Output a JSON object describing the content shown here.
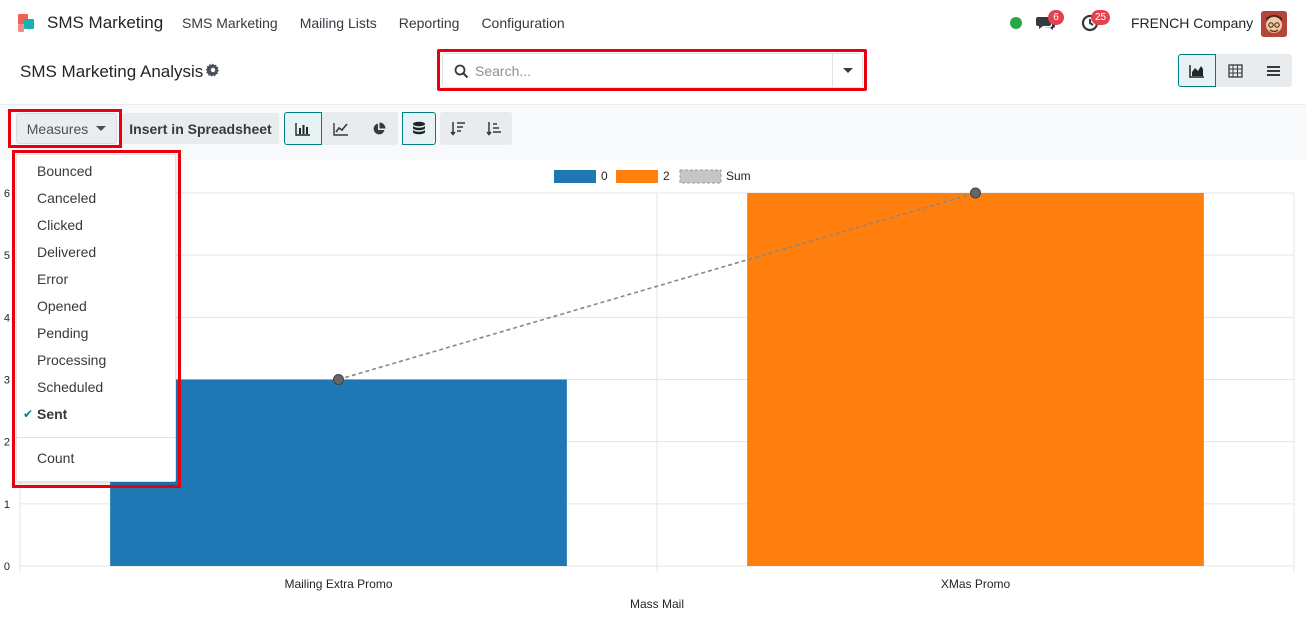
{
  "navbar": {
    "app_title": "SMS Marketing",
    "menu": [
      "SMS Marketing",
      "Mailing Lists",
      "Reporting",
      "Configuration"
    ],
    "chat_count": "6",
    "activity_count": "25",
    "company": "FRENCH Company"
  },
  "control_panel": {
    "title": "SMS Marketing Analysis",
    "search_placeholder": "Search..."
  },
  "toolbar": {
    "measures_label": "Measures",
    "spreadsheet_label": "Insert in Spreadsheet"
  },
  "measures_menu": {
    "items": [
      "Bounced",
      "Canceled",
      "Clicked",
      "Delivered",
      "Error",
      "Opened",
      "Pending",
      "Processing",
      "Scheduled",
      "Sent"
    ],
    "selected": "Sent",
    "count_label": "Count"
  },
  "colors": {
    "accent": "#017e84",
    "series_0": "#1f77b4",
    "series_2": "#ff7f0e",
    "highlight": "#e8000f"
  },
  "chart_data": {
    "type": "bar",
    "xlabel": "Mass Mail",
    "ylabel": "",
    "ylim": [
      0,
      6
    ],
    "yticks": [
      0,
      1,
      2,
      3,
      4,
      5,
      6
    ],
    "categories": [
      "Mailing Extra Promo",
      "XMas Promo"
    ],
    "series": [
      {
        "name": "0",
        "values": [
          3,
          null
        ],
        "color": "#1f77b4"
      },
      {
        "name": "2",
        "values": [
          null,
          6
        ],
        "color": "#ff7f0e"
      }
    ],
    "line_series": {
      "name": "Sum",
      "values": [
        3,
        6
      ]
    },
    "legend": "top-center",
    "grid": true
  }
}
